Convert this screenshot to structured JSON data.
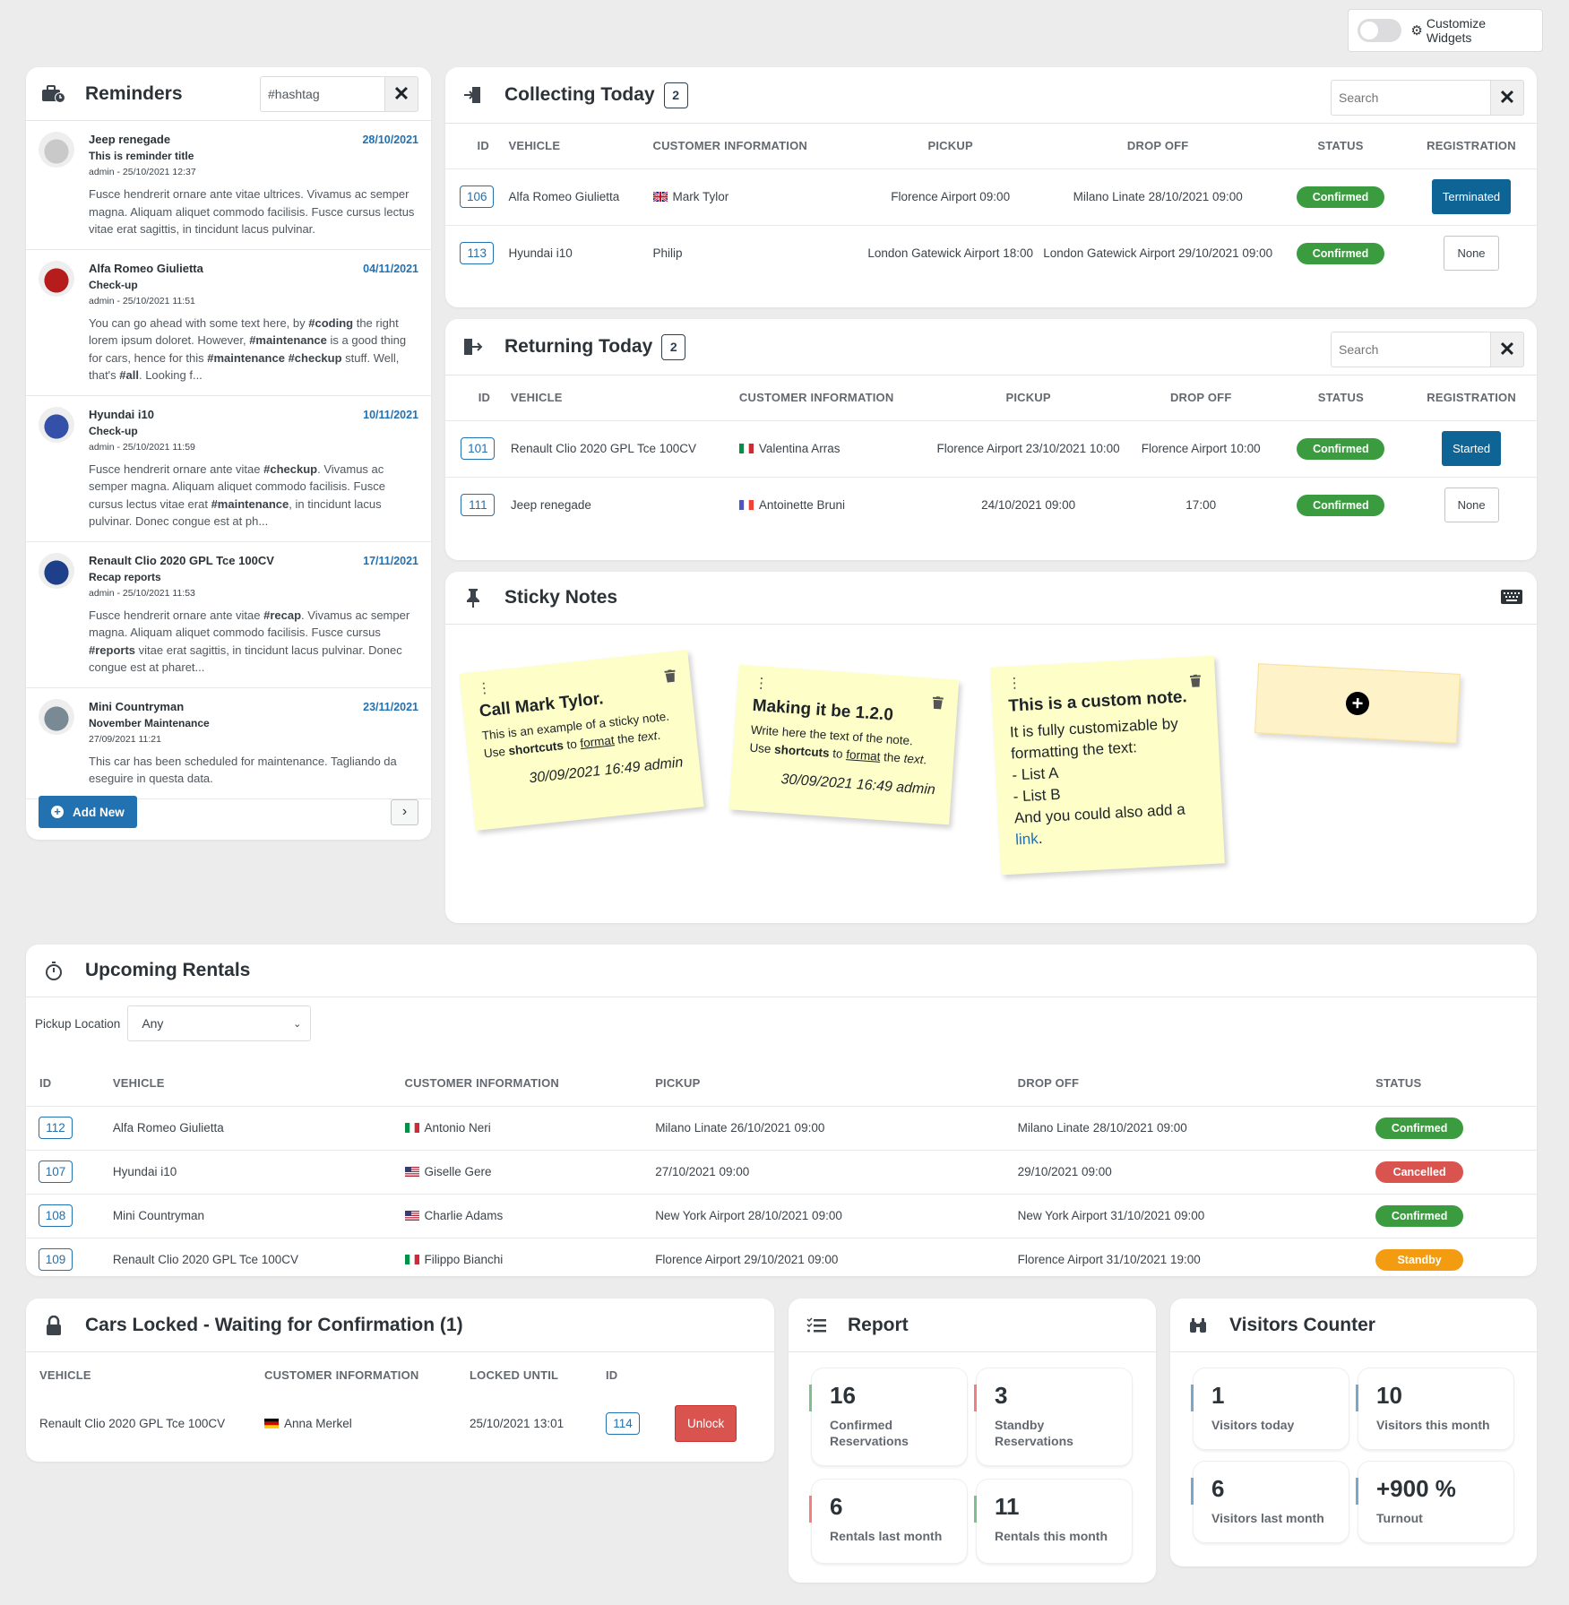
{
  "customize": {
    "label": "Customize Widgets",
    "toggle_on": false
  },
  "reminders": {
    "title": "Reminders",
    "search_value": "#hashtag",
    "add_new_label": "Add New",
    "items": [
      {
        "vehicle": "Jeep renegade",
        "date": "28/10/2021",
        "title": "This is reminder title",
        "meta": "admin - 25/10/2021 12:37",
        "text": "Fusce hendrerit ornare ante vitae ultrices. Vivamus ac semper magna. Aliquam aliquet commodo facilisis. Fusce cursus lectus vitae erat sagittis, in tincidunt lacus pulvinar.",
        "avatar_color": "#c9c9c9"
      },
      {
        "vehicle": "Alfa Romeo Giulietta",
        "date": "04/11/2021",
        "title": "Check-up",
        "meta": "admin - 25/10/2021 11:51",
        "text": "You can go ahead with some text here, by #coding the right lorem ipsum doloret. However, #maintenance is a good thing for cars, hence for this #maintenance #checkup stuff. Well, that's #all. Looking f...",
        "avatar_color": "#b71c1c"
      },
      {
        "vehicle": "Hyundai i10",
        "date": "10/11/2021",
        "title": "Check-up",
        "meta": "admin - 25/10/2021 11:59",
        "text": "Fusce hendrerit ornare ante vitae #checkup. Vivamus ac semper magna. Aliquam aliquet commodo facilisis. Fusce cursus lectus vitae erat #maintenance, in tincidunt lacus pulvinar. Donec congue est at ph...",
        "avatar_color": "#3450a8"
      },
      {
        "vehicle": "Renault Clio 2020 GPL Tce 100CV",
        "date": "17/11/2021",
        "title": "Recap reports",
        "meta": "admin - 25/10/2021 11:53",
        "text": "Fusce hendrerit ornare ante vitae #recap. Vivamus ac semper magna. Aliquam aliquet commodo facilisis. Fusce cursus #reports vitae erat sagittis, in tincidunt lacus pulvinar. Donec congue est at pharet...",
        "avatar_color": "#1e3f8a"
      },
      {
        "vehicle": "Mini Countryman",
        "date": "23/11/2021",
        "title": "November Maintenance",
        "meta": "27/09/2021 11:21",
        "text": "This car has been scheduled for maintenance. Tagliando da eseguire in questa data.",
        "avatar_color": "#7a8a95"
      }
    ]
  },
  "collecting": {
    "title": "Collecting Today",
    "count": "2",
    "search_placeholder": "Search",
    "columns": [
      "ID",
      "VEHICLE",
      "CUSTOMER INFORMATION",
      "PICKUP",
      "DROP OFF",
      "STATUS",
      "REGISTRATION"
    ],
    "rows": [
      {
        "id": "106",
        "vehicle": "Alfa Romeo Giulietta",
        "flag": "uk",
        "customer": "Mark Tylor",
        "pickup": "Florence Airport 09:00",
        "dropoff": "Milano Linate 28/10/2021 09:00",
        "status": "Confirmed",
        "status_kind": "confirmed",
        "registration": "Terminated",
        "reg_kind": "blue"
      },
      {
        "id": "113",
        "vehicle": "Hyundai i10",
        "flag": "",
        "customer": "Philip",
        "pickup": "London Gatewick Airport 18:00",
        "dropoff": "London Gatewick Airport 29/10/2021 09:00",
        "status": "Confirmed",
        "status_kind": "confirmed",
        "registration": "None",
        "reg_kind": "plain"
      }
    ]
  },
  "returning": {
    "title": "Returning Today",
    "count": "2",
    "search_placeholder": "Search",
    "columns": [
      "ID",
      "VEHICLE",
      "CUSTOMER INFORMATION",
      "PICKUP",
      "DROP OFF",
      "STATUS",
      "REGISTRATION"
    ],
    "rows": [
      {
        "id": "101",
        "vehicle": "Renault Clio 2020 GPL Tce 100CV",
        "flag": "it",
        "customer": "Valentina Arras",
        "pickup": "Florence Airport 23/10/2021 10:00",
        "dropoff": "Florence Airport 10:00",
        "status": "Confirmed",
        "status_kind": "confirmed",
        "registration": "Started",
        "reg_kind": "blue"
      },
      {
        "id": "111",
        "vehicle": "Jeep renegade",
        "flag": "fr",
        "customer": "Antoinette Bruni",
        "pickup": "24/10/2021 09:00",
        "dropoff": "17:00",
        "status": "Confirmed",
        "status_kind": "confirmed",
        "registration": "None",
        "reg_kind": "plain"
      }
    ]
  },
  "sticky": {
    "title": "Sticky Notes",
    "notes": [
      {
        "title": "Call Mark Tylor.",
        "line1": "This is an example of a sticky note.",
        "line2_pre": "Use ",
        "line2_bold": "shortcuts",
        "line2_mid": " to ",
        "line2_u": "format",
        "line2_mid2": " the ",
        "line2_i": "text",
        "line2_end": ".",
        "signature": "30/09/2021 16:49 admin"
      },
      {
        "title": "Making it be 1.2.0",
        "line1": "Write here the text of the note.",
        "line2_pre": "Use ",
        "line2_bold": "shortcuts",
        "line2_mid": " to ",
        "line2_u": "format",
        "line2_mid2": " the ",
        "line2_i": "text",
        "line2_end": ".",
        "signature": "30/09/2021 16:49 admin"
      },
      {
        "title": "This is a custom note.",
        "body1": "It is fully customizable by formatting the text:",
        "list": [
          "- List A",
          "- List B"
        ],
        "body2": "And you could also add a ",
        "link": "link",
        "body2_end": "."
      }
    ]
  },
  "upcoming": {
    "title": "Upcoming Rentals",
    "filter_label": "Pickup Location",
    "filter_value": "Any",
    "columns": [
      "ID",
      "VEHICLE",
      "CUSTOMER INFORMATION",
      "PICKUP",
      "DROP OFF",
      "STATUS"
    ],
    "rows": [
      {
        "id": "112",
        "vehicle": "Alfa Romeo Giulietta",
        "flag": "it",
        "customer": "Antonio Neri",
        "pickup": "Milano Linate 26/10/2021 09:00",
        "dropoff": "Milano Linate 28/10/2021 09:00",
        "status": "Confirmed",
        "status_kind": "confirmed"
      },
      {
        "id": "107",
        "vehicle": "Hyundai i10",
        "flag": "us",
        "customer": "Giselle Gere",
        "pickup": "27/10/2021 09:00",
        "dropoff": "29/10/2021 09:00",
        "status": "Cancelled",
        "status_kind": "cancelled"
      },
      {
        "id": "108",
        "vehicle": "Mini Countryman",
        "flag": "us",
        "customer": "Charlie Adams",
        "pickup": "New York Airport 28/10/2021 09:00",
        "dropoff": "New York Airport 31/10/2021 09:00",
        "status": "Confirmed",
        "status_kind": "confirmed"
      },
      {
        "id": "109",
        "vehicle": "Renault Clio 2020 GPL Tce 100CV",
        "flag": "it",
        "customer": "Filippo Bianchi",
        "pickup": "Florence Airport 29/10/2021 09:00",
        "dropoff": "Florence Airport 31/10/2021 19:00",
        "status": "Standby",
        "status_kind": "standby"
      }
    ]
  },
  "locked": {
    "title": "Cars Locked - Waiting for Confirmation (1)",
    "columns": [
      "VEHICLE",
      "CUSTOMER INFORMATION",
      "LOCKED UNTIL",
      "ID"
    ],
    "rows": [
      {
        "vehicle": "Renault Clio 2020 GPL Tce 100CV",
        "flag": "de",
        "customer": "Anna Merkel",
        "locked_until": "25/10/2021 13:01",
        "id": "114",
        "action": "Unlock"
      }
    ]
  },
  "report": {
    "title": "Report",
    "stats": [
      {
        "value": "16",
        "label": "Confirmed Reservations",
        "accent": "#7dc08f"
      },
      {
        "value": "3",
        "label": "Standby Reservations",
        "accent": "#f08080"
      },
      {
        "value": "6",
        "label": "Rentals last month",
        "accent": "#f08080"
      },
      {
        "value": "11",
        "label": "Rentals this month",
        "accent": "#7dc08f"
      }
    ]
  },
  "visitors": {
    "title": "Visitors Counter",
    "stats": [
      {
        "value": "1",
        "label": "Visitors today",
        "accent": "#7aa7c7"
      },
      {
        "value": "10",
        "label": "Visitors this month",
        "accent": "#7aa7c7"
      },
      {
        "value": "6",
        "label": "Visitors last month",
        "accent": "#7aa7c7"
      },
      {
        "value": "+900 %",
        "label": "Turnout",
        "accent": "#7aa7c7"
      }
    ]
  }
}
